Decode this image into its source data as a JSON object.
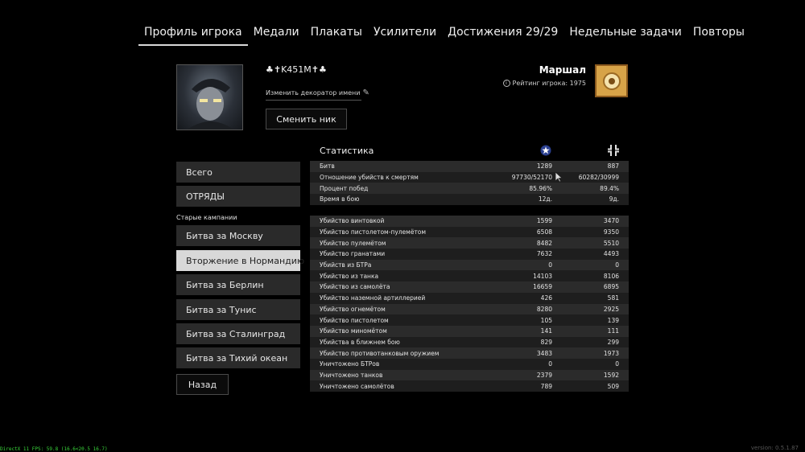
{
  "nav": {
    "tabs": [
      {
        "label": "Профиль игрока",
        "active": true
      },
      {
        "label": "Медали"
      },
      {
        "label": "Плакаты"
      },
      {
        "label": "Усилители"
      },
      {
        "label": "Достижения 29/29"
      },
      {
        "label": "Недельные задачи"
      },
      {
        "label": "Повторы"
      }
    ]
  },
  "profile": {
    "nickname": "♣✝K451M✝♣",
    "decorator_label": "Изменить декоратор имени",
    "change_nick_label": "Сменить ник",
    "rank_name": "Маршал",
    "rating_label": "Рейтинг игрока: 1975"
  },
  "menu": {
    "all_label": "Всего",
    "squads_label": "ОТРЯДЫ",
    "old_campaigns_label": "Старые кампании",
    "campaigns": [
      {
        "label": "Битва за Москву"
      },
      {
        "label": "Вторжение в Нормандию",
        "active": true
      },
      {
        "label": "Битва за Берлин"
      },
      {
        "label": "Битва за Тунис"
      },
      {
        "label": "Битва за Сталинград"
      },
      {
        "label": "Битва за Тихий океан"
      }
    ],
    "back_label": "Назад"
  },
  "stats": {
    "title": "Статистика",
    "summary": [
      {
        "label": "Битв",
        "v1": "1289",
        "v2": "887"
      },
      {
        "label": "Отношение убийств к смертям",
        "v1": "97730/52170",
        "v2": "60282/30999"
      },
      {
        "label": "Процент побед",
        "v1": "85.96%",
        "v2": "89.4%"
      },
      {
        "label": "Время в бою",
        "v1": "12д.",
        "v2": "9д."
      }
    ],
    "details": [
      {
        "label": "Убийство винтовкой",
        "v1": "1599",
        "v2": "3470"
      },
      {
        "label": "Убийство пистолетом-пулемётом",
        "v1": "6508",
        "v2": "9350"
      },
      {
        "label": "Убийство пулемётом",
        "v1": "8482",
        "v2": "5510"
      },
      {
        "label": "Убийство гранатами",
        "v1": "7632",
        "v2": "4493"
      },
      {
        "label": "Убийств из БТРа",
        "v1": "0",
        "v2": "0"
      },
      {
        "label": "Убийство из танка",
        "v1": "14103",
        "v2": "8106"
      },
      {
        "label": "Убийство из самолёта",
        "v1": "16659",
        "v2": "6895"
      },
      {
        "label": "Убийство наземной артиллерией",
        "v1": "426",
        "v2": "581"
      },
      {
        "label": "Убийство огнемётом",
        "v1": "8280",
        "v2": "2925"
      },
      {
        "label": "Убийство пистолетом",
        "v1": "105",
        "v2": "139"
      },
      {
        "label": "Убийство миномётом",
        "v1": "141",
        "v2": "111"
      },
      {
        "label": "Убийства в ближнем бою",
        "v1": "829",
        "v2": "299"
      },
      {
        "label": "Убийство противотанковым оружием",
        "v1": "3483",
        "v2": "1973"
      },
      {
        "label": "Уничтожено БТРов",
        "v1": "0",
        "v2": "0"
      },
      {
        "label": "Уничтожено танков",
        "v1": "2379",
        "v2": "1592"
      },
      {
        "label": "Уничтожено самолётов",
        "v1": "789",
        "v2": "509"
      }
    ]
  },
  "footer": {
    "fps": "DirectX 11 FPS: 59.8 (16.6<20.5 16.7)",
    "version": "version: 0.5.1.87"
  },
  "colors": {
    "allies_icon": "#2a3f8f",
    "axis_icon": "#e0e0e0",
    "rank_badge": "#d7a348",
    "active_menu": "#d8d8d8"
  }
}
